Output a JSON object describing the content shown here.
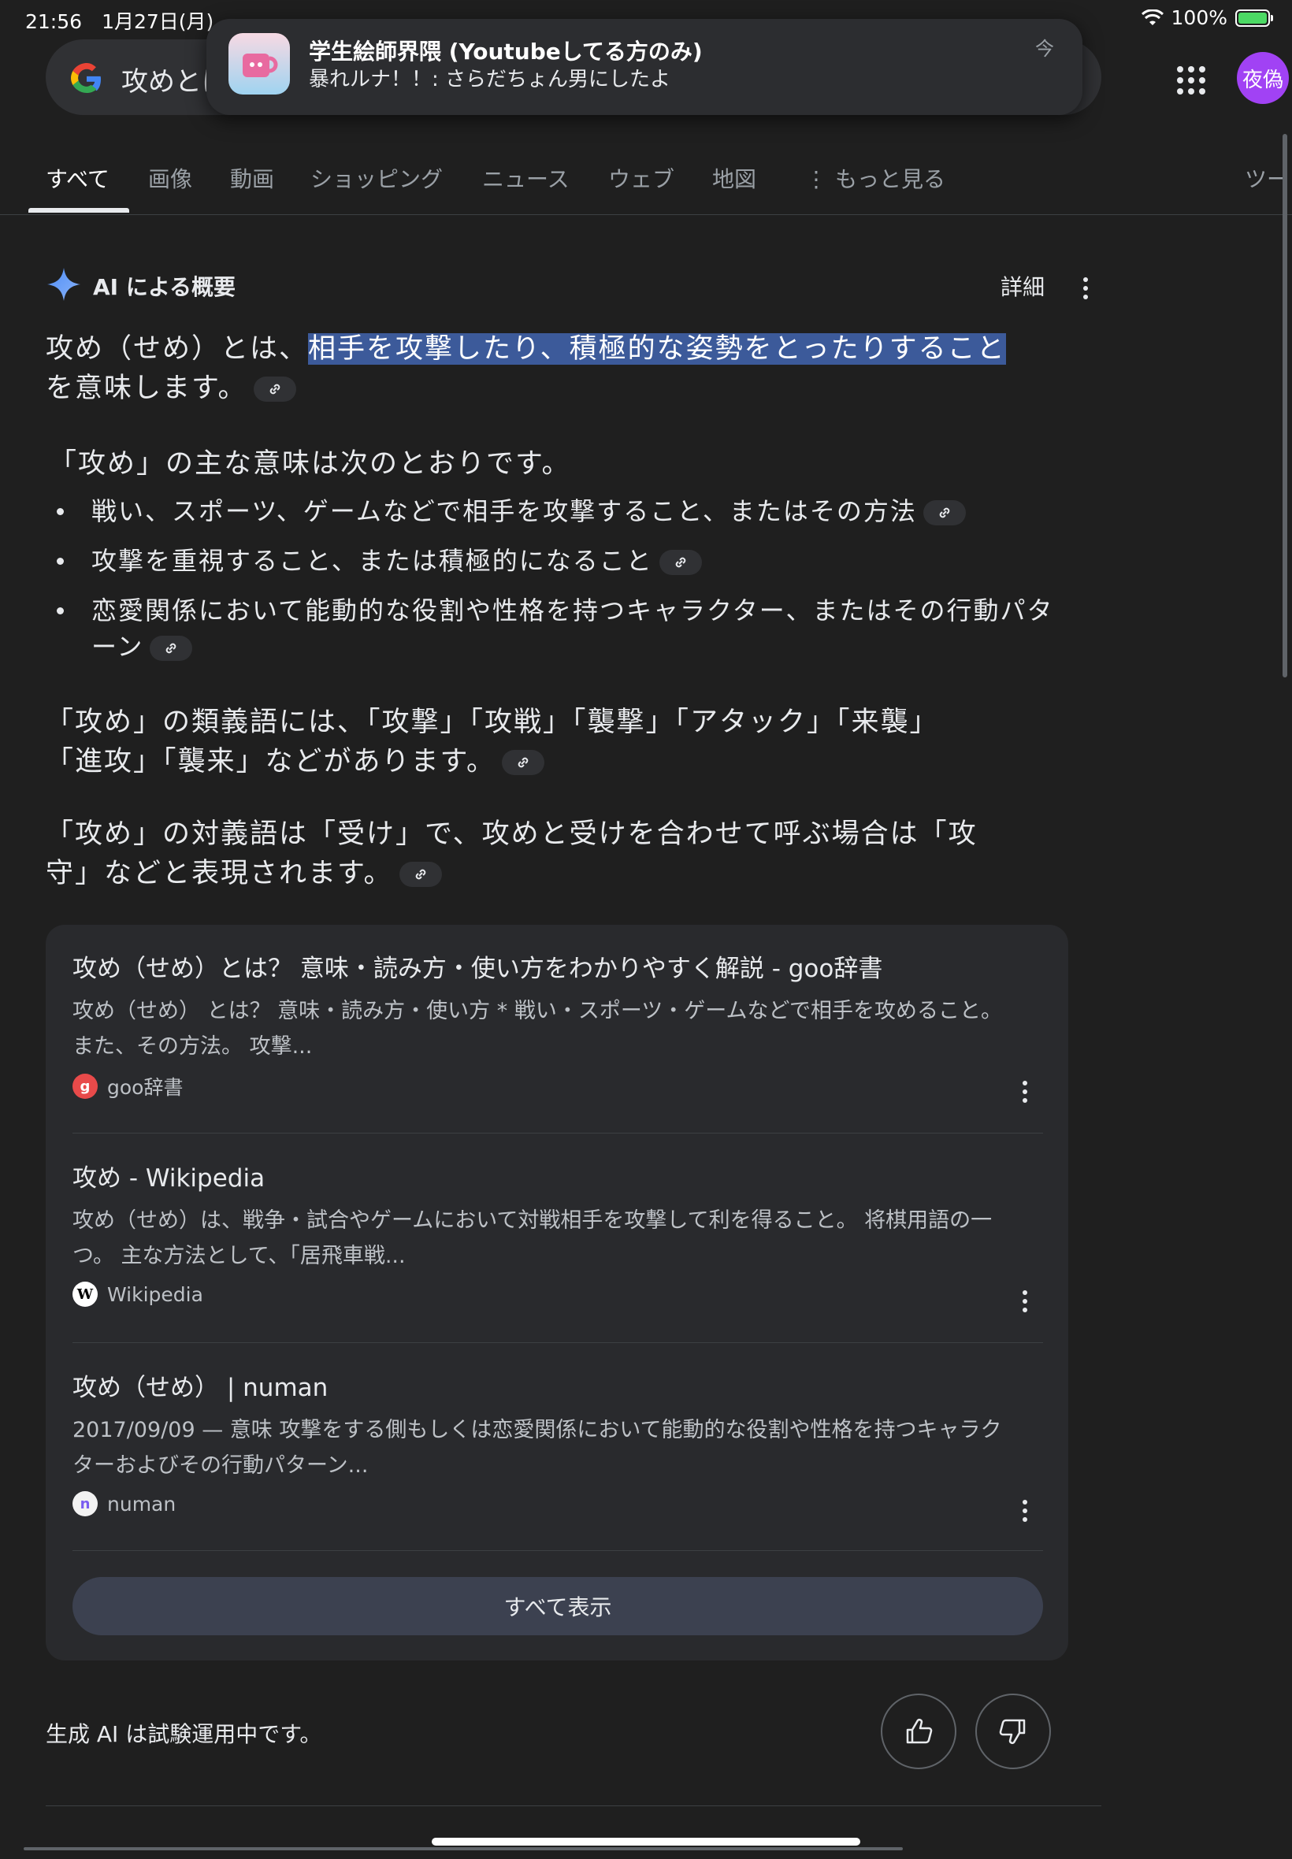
{
  "status_bar": {
    "time": "21:56",
    "date": "1月27日(月)",
    "battery": "100%"
  },
  "search": {
    "query": "攻めとは"
  },
  "account": {
    "avatar_text": "夜偽"
  },
  "notification": {
    "title": "学生絵師界隈 (Youtubeしてる方のみ)",
    "body": "暴れルナ！！: さらだちょん男にしたよ",
    "time": "今"
  },
  "tabs": [
    "すべて",
    "画像",
    "動画",
    "ショッピング",
    "ニュース",
    "ウェブ",
    "地図",
    "もっと見る",
    "ツー"
  ],
  "ai_overview": {
    "label": "AI による概要",
    "detail": "詳細",
    "intro_prefix": "攻め（せめ）とは、",
    "intro_highlight": "相手を攻撃したり、積極的な姿勢をとったりすること",
    "intro_suffix": "を意味します。",
    "subhead": "「攻め」の主な意味は次のとおりです。",
    "bullets": [
      "戦い、スポーツ、ゲームなどで相手を攻撃すること、またはその方法",
      "攻撃を重視すること、または積極的になること",
      "恋愛関係において能動的な役割や性格を持つキャラクター、またはその行動パターン"
    ],
    "synonyms_line1": "「攻め」の類義語には、「攻撃」「攻戦」「襲撃」「アタック」「来襲」",
    "synonyms_line2": "「進攻」「襲来」などがあります。",
    "antonym_line1": "「攻め」の対義語は「受け」で、攻めと受けを合わせて呼ぶ場合は「攻",
    "antonym_line2": "守」などと表現されます。"
  },
  "sources": [
    {
      "title": "攻め（せめ）とは？ 意味・読み方・使い方をわかりやすく解説 - goo辞書",
      "snippet": "攻め（せめ） とは？ 意味・読み方・使い方 * 戦い・スポーツ・ゲームなどで相手を攻めること。 また、その方法。 攻撃...",
      "site": "goo辞書",
      "favicon_color": "#e84a4a"
    },
    {
      "title": "攻め - Wikipedia",
      "snippet": "攻め（せめ）は、戦争・試合やゲームにおいて対戦相手を攻撃して利を得ること。 将棋用語の一つ。 主な方法として、「居飛車戦...",
      "site": "Wikipedia",
      "favicon_color": "#ffffff"
    },
    {
      "title": "攻め（せめ） | numan",
      "snippet": "2017/09/09 — 意味 攻撃をする側もしくは恋愛関係において能動的な役割や性格を持つキャラクターおよびその行動パターン...",
      "site": "numan",
      "favicon_color": "#f2f2f2"
    }
  ],
  "show_all": "すべて表示",
  "footer": {
    "note": "生成 AI は試験運用中です。"
  },
  "colors": {
    "background": "#1f1f1f",
    "highlight": "#3c5a9a",
    "card": "#292a2d",
    "avatar": "#a142f4"
  }
}
